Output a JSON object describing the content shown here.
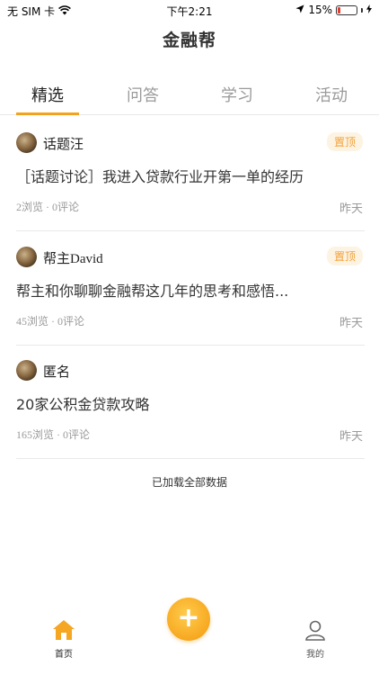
{
  "status_bar": {
    "carrier": "无 SIM 卡",
    "time": "下午2:21",
    "battery_percent": "15%",
    "battery_level": 0.15
  },
  "header": {
    "title": "金融帮"
  },
  "tabs": [
    {
      "label": "精选",
      "active": true
    },
    {
      "label": "问答",
      "active": false
    },
    {
      "label": "学习",
      "active": false
    },
    {
      "label": "活动",
      "active": false
    }
  ],
  "posts": [
    {
      "author": "话题汪",
      "pinned": true,
      "pin_label": "置顶",
      "title": "［话题讨论］我进入贷款行业开第一单的经历",
      "views": "2浏览",
      "comments": "0评论",
      "date": "昨天"
    },
    {
      "author": "帮主David",
      "pinned": true,
      "pin_label": "置顶",
      "title": "帮主和你聊聊金融帮这几年的思考和感悟...",
      "views": "45浏览",
      "comments": "0评论",
      "date": "昨天"
    },
    {
      "author": "匿名",
      "pinned": false,
      "pin_label": "",
      "title": "20家公积金贷款攻略",
      "views": "165浏览",
      "comments": "0评论",
      "date": "昨天"
    }
  ],
  "footer_note": "已加载全部数据",
  "bottom_nav": {
    "home_label": "首页",
    "add_symbol": "+",
    "me_label": "我的"
  },
  "colors": {
    "accent": "#f3a21b",
    "badge_bg": "#fdf3e3",
    "badge_text": "#f2a23a",
    "battery_low": "#e23a2e"
  }
}
